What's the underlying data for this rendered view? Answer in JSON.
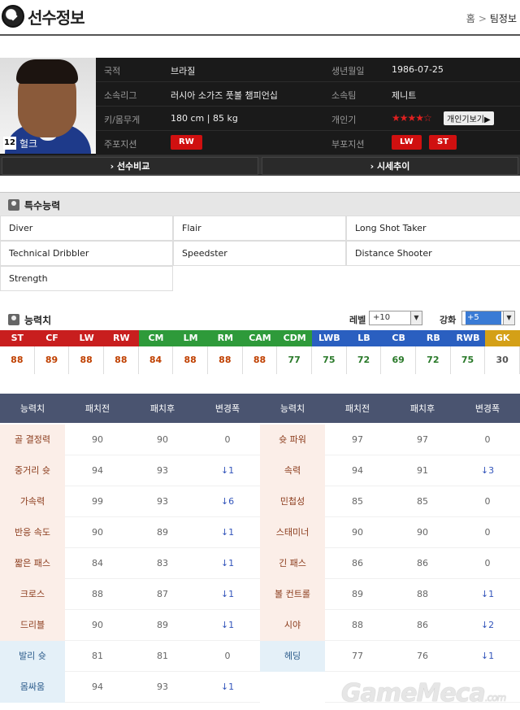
{
  "header": {
    "title": "선수정보",
    "breadcrumb": [
      "홈",
      "팀정보"
    ],
    "breadcrumb_sep": ">"
  },
  "profile": {
    "number": "12",
    "name": "헐크",
    "rows": [
      {
        "l1": "국적",
        "v1": "브라질",
        "l2": "생년월일",
        "v2": "1986-07-25"
      },
      {
        "l1": "소속리그",
        "v1": "러시아 소가즈 풋볼 챔피언십",
        "l2": "소속팀",
        "v2": "제니트"
      },
      {
        "l1": "키/몸무게",
        "v1": "180 cm | 85 kg",
        "l2": "개인기",
        "v2": ""
      },
      {
        "l1": "주포지션",
        "v1": "",
        "l2": "부포지션",
        "v2": ""
      }
    ],
    "stars": "★★★★☆",
    "star_button": "개인기보기▶",
    "main_positions": [
      "RW"
    ],
    "sub_positions": [
      "LW",
      "ST"
    ]
  },
  "buttons": {
    "compare": "› 선수비교",
    "market": "› 시세추이"
  },
  "traits": {
    "title": "특수능력",
    "items": [
      "Diver",
      "Flair",
      "Long Shot Taker",
      "Technical Dribbler",
      "Speedster",
      "Distance Shooter",
      "Strength"
    ]
  },
  "abilities": {
    "title": "능력치",
    "level_label": "레벨",
    "level_value": "+10",
    "enhance_label": "강화",
    "enhance_value": "+5",
    "positions": [
      {
        "pos": "ST",
        "val": "88",
        "color": "#c81e1e",
        "txt": "#c04000"
      },
      {
        "pos": "CF",
        "val": "89",
        "color": "#c81e1e",
        "txt": "#c04000"
      },
      {
        "pos": "LW",
        "val": "88",
        "color": "#c81e1e",
        "txt": "#c04000"
      },
      {
        "pos": "RW",
        "val": "88",
        "color": "#c81e1e",
        "txt": "#c04000"
      },
      {
        "pos": "CM",
        "val": "84",
        "color": "#2e9a3a",
        "txt": "#c04000"
      },
      {
        "pos": "LM",
        "val": "88",
        "color": "#2e9a3a",
        "txt": "#c04000"
      },
      {
        "pos": "RM",
        "val": "88",
        "color": "#2e9a3a",
        "txt": "#c04000"
      },
      {
        "pos": "CAM",
        "val": "88",
        "color": "#2e9a3a",
        "txt": "#c04000"
      },
      {
        "pos": "CDM",
        "val": "77",
        "color": "#2e9a3a",
        "txt": "#2a7a2a"
      },
      {
        "pos": "LWB",
        "val": "75",
        "color": "#2a5fc0",
        "txt": "#2a7a2a"
      },
      {
        "pos": "LB",
        "val": "72",
        "color": "#2a5fc0",
        "txt": "#2a7a2a"
      },
      {
        "pos": "CB",
        "val": "69",
        "color": "#2a5fc0",
        "txt": "#2a7a2a"
      },
      {
        "pos": "RB",
        "val": "72",
        "color": "#2a5fc0",
        "txt": "#2a7a2a"
      },
      {
        "pos": "RWB",
        "val": "75",
        "color": "#2a5fc0",
        "txt": "#2a7a2a"
      },
      {
        "pos": "GK",
        "val": "30",
        "color": "#d4a017",
        "txt": "#555555"
      }
    ]
  },
  "stats": {
    "headers": [
      "능력치",
      "패치전",
      "패치후",
      "변경폭",
      "능력치",
      "패치전",
      "패치후",
      "변경폭"
    ],
    "rows": [
      {
        "a": "골 결정력",
        "a1": "90",
        "a2": "90",
        "ad": "0",
        "b": "슛 파워",
        "b1": "97",
        "b2": "97",
        "bd": "0",
        "cat": "atk"
      },
      {
        "a": "중거리 슛",
        "a1": "94",
        "a2": "93",
        "ad": "↓1",
        "b": "속력",
        "b1": "94",
        "b2": "91",
        "bd": "↓3",
        "cat": "atk"
      },
      {
        "a": "가속력",
        "a1": "99",
        "a2": "93",
        "ad": "↓6",
        "b": "민첩성",
        "b1": "85",
        "b2": "85",
        "bd": "0",
        "cat": "atk"
      },
      {
        "a": "반응 속도",
        "a1": "90",
        "a2": "89",
        "ad": "↓1",
        "b": "스태미너",
        "b1": "90",
        "b2": "90",
        "bd": "0",
        "cat": "atk"
      },
      {
        "a": "짧은 패스",
        "a1": "84",
        "a2": "83",
        "ad": "↓1",
        "b": "긴 패스",
        "b1": "86",
        "b2": "86",
        "bd": "0",
        "cat": "atk"
      },
      {
        "a": "크로스",
        "a1": "88",
        "a2": "87",
        "ad": "↓1",
        "b": "볼 컨트롤",
        "b1": "89",
        "b2": "88",
        "bd": "↓1",
        "cat": "atk"
      },
      {
        "a": "드리블",
        "a1": "90",
        "a2": "89",
        "ad": "↓1",
        "b": "시야",
        "b1": "88",
        "b2": "86",
        "bd": "↓2",
        "cat": "atk"
      },
      {
        "a": "발리 슛",
        "a1": "81",
        "a2": "81",
        "ad": "0",
        "b": "헤딩",
        "b1": "77",
        "b2": "76",
        "bd": "↓1",
        "cat": "mid"
      },
      {
        "a": "몸싸움",
        "a1": "94",
        "a2": "93",
        "ad": "↓1",
        "b": "",
        "b1": "",
        "b2": "",
        "bd": "",
        "cat": "mid"
      }
    ]
  },
  "watermark": {
    "text": "GameMeca",
    "suffix": ".com"
  }
}
